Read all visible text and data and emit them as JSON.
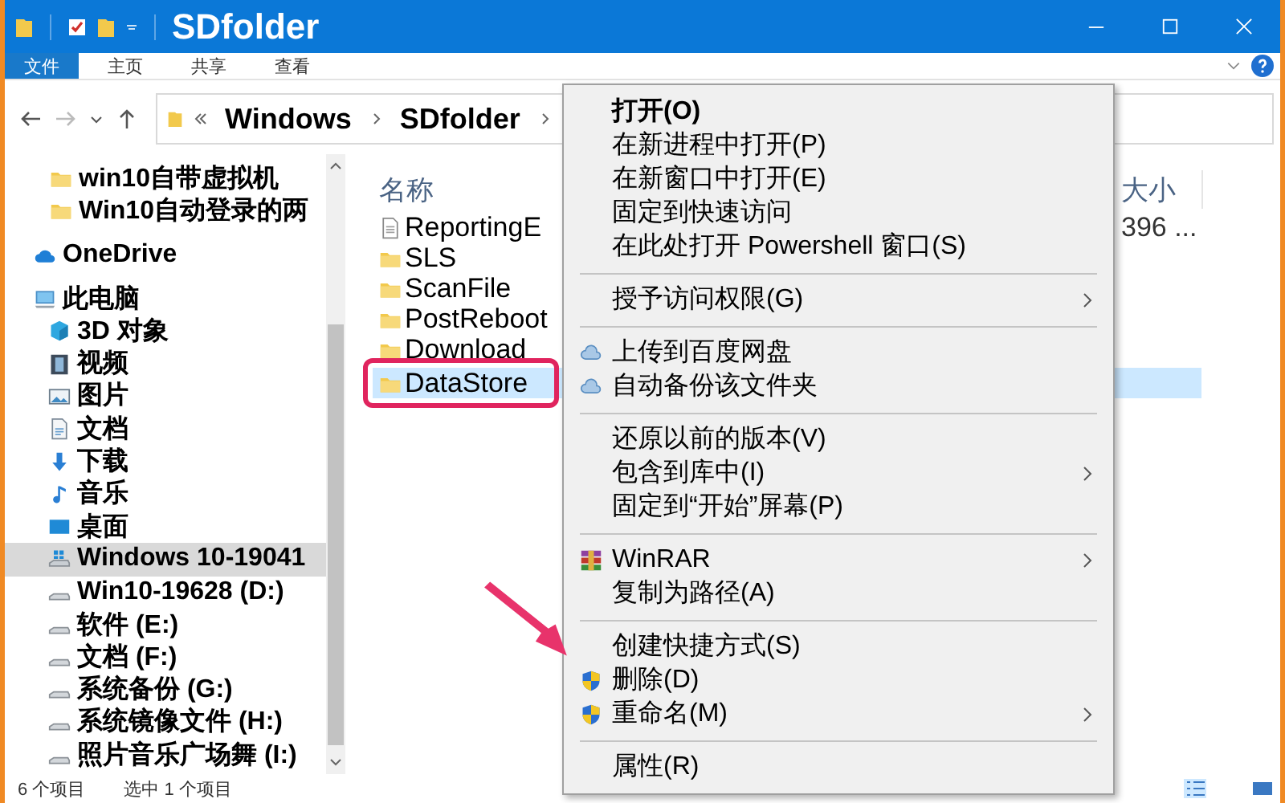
{
  "window": {
    "title": "SDfolder"
  },
  "ribbon_tabs": [
    {
      "label": "文件",
      "selected": true
    },
    {
      "label": "主页",
      "selected": false
    },
    {
      "label": "共享",
      "selected": false
    },
    {
      "label": "查看",
      "selected": false
    }
  ],
  "address": {
    "path": [
      "Windows",
      "SDfolder"
    ]
  },
  "sidebar": {
    "items": [
      {
        "label": "win10自带虚拟机",
        "kind": "folder",
        "selected": false
      },
      {
        "label": "Win10自动登录的两",
        "kind": "folder",
        "selected": false
      },
      {
        "label": "OneDrive",
        "kind": "cloud",
        "selected": false
      },
      {
        "label": "此电脑",
        "kind": "pc",
        "selected": false,
        "children": [
          {
            "label": "3D 对象",
            "kind": "cube",
            "selected": false
          },
          {
            "label": "视频",
            "kind": "video",
            "selected": false
          },
          {
            "label": "图片",
            "kind": "picture",
            "selected": false
          },
          {
            "label": "文档",
            "kind": "doc",
            "selected": false
          },
          {
            "label": "下载",
            "kind": "download",
            "selected": false
          },
          {
            "label": "音乐",
            "kind": "music",
            "selected": false
          },
          {
            "label": "桌面",
            "kind": "desktop",
            "selected": false
          },
          {
            "label": "Windows 10-19041",
            "kind": "windrive",
            "selected": true
          },
          {
            "label": "Win10-19628 (D:)",
            "kind": "drive",
            "selected": false
          },
          {
            "label": "软件 (E:)",
            "kind": "drive",
            "selected": false
          },
          {
            "label": "文档 (F:)",
            "kind": "drive",
            "selected": false
          },
          {
            "label": "系统备份 (G:)",
            "kind": "drive",
            "selected": false
          },
          {
            "label": "系统镜像文件 (H:)",
            "kind": "drive",
            "selected": false
          },
          {
            "label": "照片音乐广场舞 (I:)",
            "kind": "drive",
            "selected": false
          }
        ]
      }
    ]
  },
  "file_list": {
    "columns": [
      "名称",
      "大小"
    ],
    "rows": [
      {
        "name": "ReportingE",
        "kind": "file",
        "size": "396 ...",
        "selected": false
      },
      {
        "name": "SLS",
        "kind": "folder",
        "selected": false
      },
      {
        "name": "ScanFile",
        "kind": "folder",
        "selected": false
      },
      {
        "name": "PostReboot",
        "kind": "folder",
        "selected": false
      },
      {
        "name": "Download",
        "kind": "folder",
        "selected": false
      },
      {
        "name": "DataStore",
        "kind": "folder",
        "selected": true
      }
    ]
  },
  "context_menu": {
    "items": [
      {
        "kind": "plain",
        "label": "打开(O)",
        "default": true,
        "submenu": false
      },
      {
        "kind": "plain",
        "label": "在新进程中打开(P)",
        "default": false,
        "submenu": false
      },
      {
        "kind": "plain",
        "label": "在新窗口中打开(E)",
        "default": false,
        "submenu": false
      },
      {
        "kind": "plain",
        "label": "固定到快速访问",
        "default": false,
        "submenu": false
      },
      {
        "kind": "plain",
        "label": "在此处打开 Powershell 窗口(S)",
        "default": false,
        "submenu": false
      },
      {
        "kind": "separator"
      },
      {
        "kind": "plain",
        "label": "授予访问权限(G)",
        "default": false,
        "submenu": true
      },
      {
        "kind": "separator"
      },
      {
        "kind": "netcloud",
        "label": "上传到百度网盘",
        "default": false,
        "submenu": false
      },
      {
        "kind": "netcloud",
        "label": "自动备份该文件夹",
        "default": false,
        "submenu": false
      },
      {
        "kind": "separator"
      },
      {
        "kind": "plain",
        "label": "还原以前的版本(V)",
        "default": false,
        "submenu": false
      },
      {
        "kind": "plain",
        "label": "包含到库中(I)",
        "default": false,
        "submenu": true
      },
      {
        "kind": "plain",
        "label": "固定到“开始”屏幕(P)",
        "default": false,
        "submenu": false
      },
      {
        "kind": "separator"
      },
      {
        "kind": "winrar",
        "label": "WinRAR",
        "default": false,
        "submenu": true
      },
      {
        "kind": "plain",
        "label": "复制为路径(A)",
        "default": false,
        "submenu": false
      },
      {
        "kind": "separator"
      },
      {
        "kind": "plain",
        "label": "创建快捷方式(S)",
        "default": false,
        "submenu": false
      },
      {
        "kind": "shield",
        "label": "删除(D)",
        "default": false,
        "submenu": false
      },
      {
        "kind": "shield",
        "label": "重命名(M)",
        "default": false,
        "submenu": true
      },
      {
        "kind": "separator"
      },
      {
        "kind": "plain",
        "label": "属性(R)",
        "default": false,
        "submenu": false
      }
    ]
  },
  "status_bar": {
    "item_count": "6 个项目",
    "selection": "选中 1 个项目"
  }
}
